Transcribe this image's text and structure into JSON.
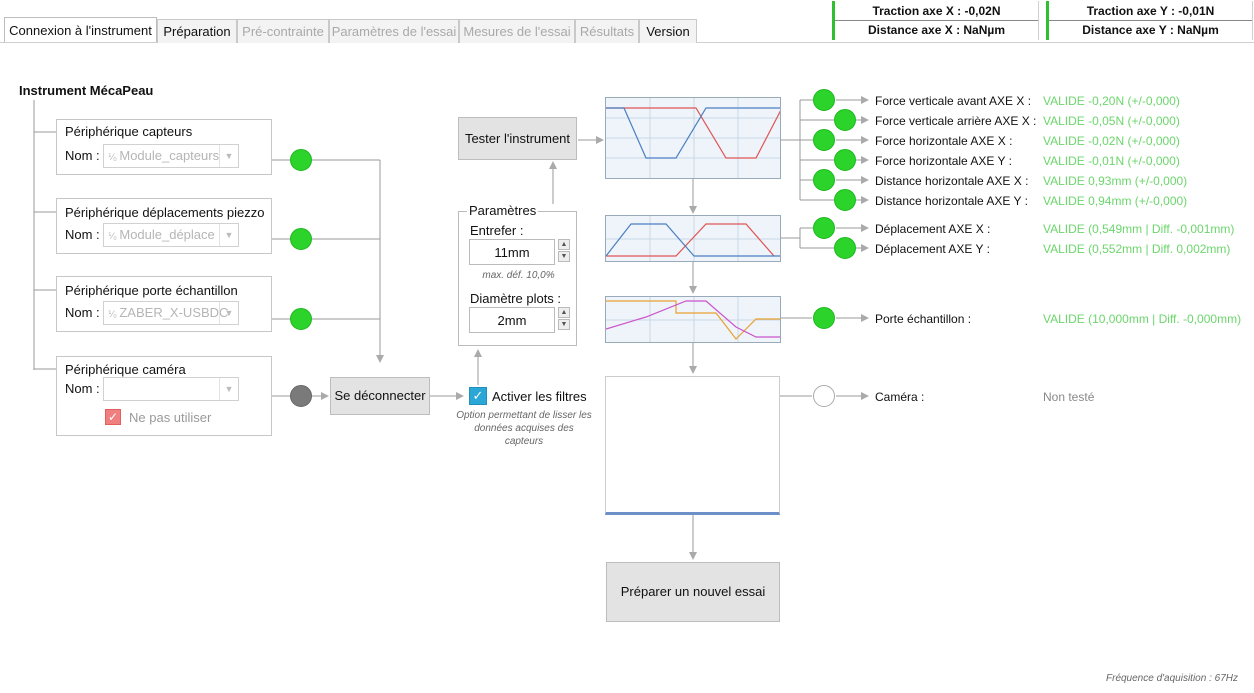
{
  "tabs": [
    {
      "label": "Connexion à l'instrument",
      "state": "active"
    },
    {
      "label": "Préparation",
      "state": "enabled"
    },
    {
      "label": "Pré-contrainte",
      "state": "disabled"
    },
    {
      "label": "Paramètres de l'essai",
      "state": "disabled"
    },
    {
      "label": "Mesures de l'essai",
      "state": "disabled"
    },
    {
      "label": "Résultats",
      "state": "disabled"
    },
    {
      "label": "Version",
      "state": "enabled"
    }
  ],
  "status": {
    "x": {
      "traction": "Traction axe X : -0,02N",
      "distance": "Distance axe X : NaNµm"
    },
    "y": {
      "traction": "Traction axe Y : -0,01N",
      "distance": "Distance axe Y : NaNµm"
    }
  },
  "instrument_title": "Instrument MécaPeau",
  "peripherals": [
    {
      "title": "Périphérique capteurs",
      "name_label": "Nom :",
      "value": "Module_capteurs",
      "status": "green"
    },
    {
      "title": "Périphérique déplacements piezzo",
      "name_label": "Nom :",
      "value": "Module_déplace",
      "status": "green"
    },
    {
      "title": "Périphérique porte échantillon",
      "name_label": "Nom :",
      "value": "ZABER_X-USBDC",
      "status": "green"
    },
    {
      "title": "Périphérique caméra",
      "name_label": "Nom :",
      "value": "",
      "status": "grey",
      "checkbox_label": "Ne pas utiliser",
      "checkbox_checked": true
    }
  ],
  "buttons": {
    "disconnect": "Se déconnecter",
    "test": "Tester l'instrument",
    "new_test": "Préparer un nouvel essai"
  },
  "params": {
    "legend": "Paramètres",
    "gap_label": "Entrefer :",
    "gap_value": "11mm",
    "gap_hint": "max. déf. 10,0%",
    "diameter_label": "Diamètre plots :",
    "diameter_value": "2mm"
  },
  "filters": {
    "label": "Activer les filtres",
    "checked": true,
    "description": "Option permettant de lisser les données acquises des capteurs"
  },
  "measurements": [
    {
      "label": "Force verticale avant AXE X :",
      "result": "VALIDE -0,20N (+/-0,000)",
      "status": "green"
    },
    {
      "label": "Force verticale arrière AXE X :",
      "result": "VALIDE -0,05N (+/-0,000)",
      "status": "green"
    },
    {
      "label": "Force horizontale AXE X :",
      "result": "VALIDE -0,02N (+/-0,000)",
      "status": "green"
    },
    {
      "label": "Force horizontale AXE Y :",
      "result": "VALIDE -0,01N (+/-0,000)",
      "status": "green"
    },
    {
      "label": "Distance horizontale AXE X :",
      "result": "VALIDE 0,93mm (+/-0,000)",
      "status": "green"
    },
    {
      "label": "Distance horizontale AXE Y :",
      "result": "VALIDE 0,94mm (+/-0,000)",
      "status": "green"
    }
  ],
  "displacements": [
    {
      "label": "Déplacement AXE X :",
      "result": "VALIDE (0,549mm | Diff. -0,001mm)",
      "status": "green"
    },
    {
      "label": "Déplacement AXE Y :",
      "result": "VALIDE (0,552mm | Diff. 0,002mm)",
      "status": "green"
    }
  ],
  "sample_holder": {
    "label": "Porte échantillon :",
    "result": "VALIDE (10,000mm | Diff. -0,000mm)",
    "status": "green"
  },
  "camera": {
    "label": "Caméra :",
    "result": "Non testé",
    "status": "empty"
  },
  "frequency": "Fréquence d'aquisition :  67Hz",
  "colors": {
    "valid": "#6cd66c",
    "green_dot": "#2bd32b",
    "status_bar": "#2fbf2f",
    "chart_blue": "#4a7fc1",
    "chart_red": "#e05555",
    "chart_orange": "#e8a030",
    "chart_magenta": "#cc55cc"
  }
}
